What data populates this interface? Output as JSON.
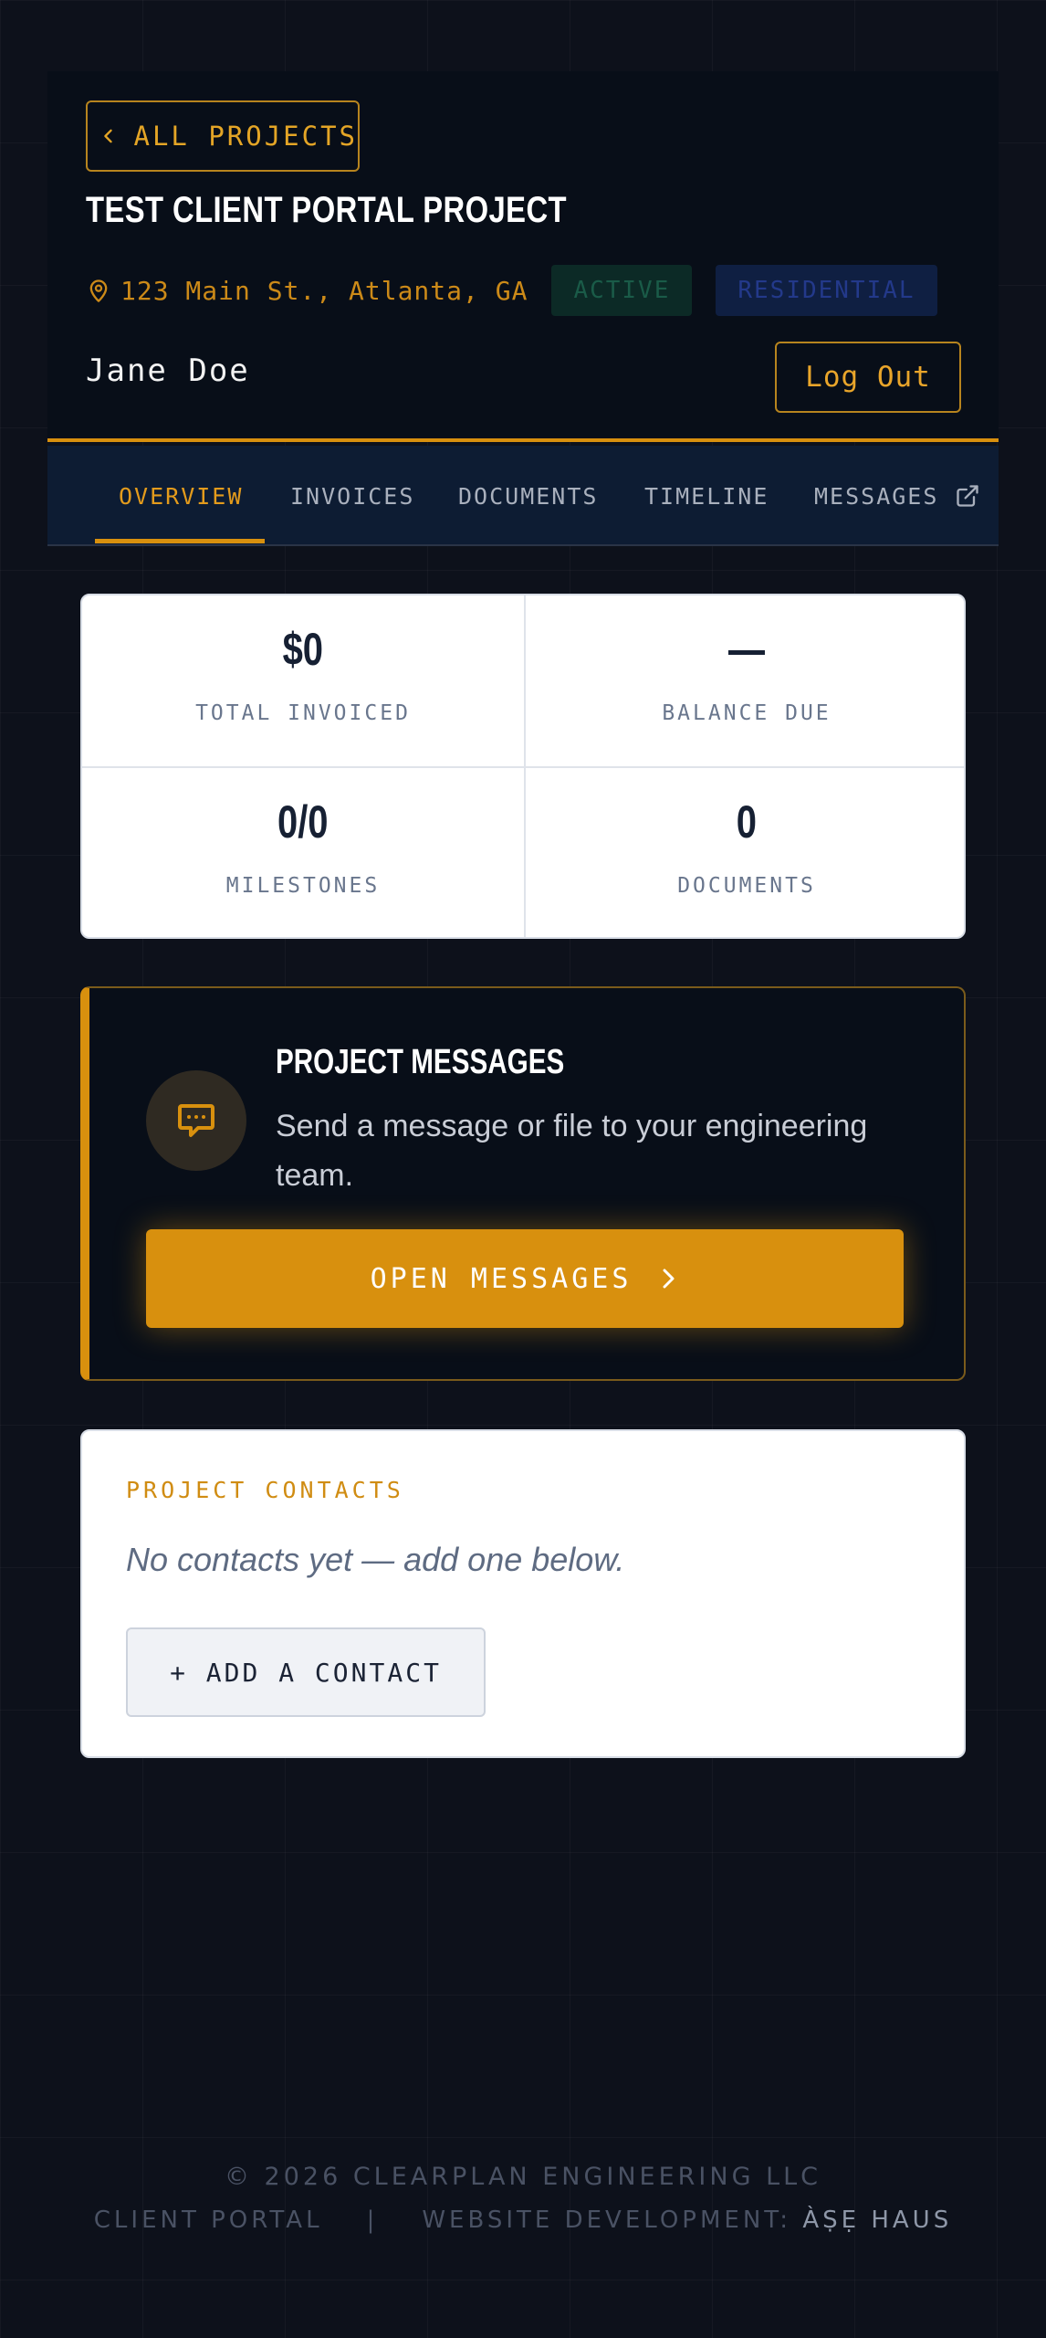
{
  "header": {
    "back_label": "ALL PROJECTS",
    "title": "TEST CLIENT PORTAL PROJECT",
    "location": "123 Main St., Atlanta, GA",
    "status_badge": "ACTIVE",
    "type_badge": "RESIDENTIAL",
    "user_name": "Jane Doe",
    "logout_label": "Log Out"
  },
  "tabs": [
    {
      "label": "OVERVIEW",
      "active": true
    },
    {
      "label": "INVOICES"
    },
    {
      "label": "DOCUMENTS"
    },
    {
      "label": "TIMELINE"
    },
    {
      "label": "MESSAGES",
      "icon": "external-link-icon"
    }
  ],
  "stats": [
    {
      "value": "$0",
      "label": "TOTAL INVOICED"
    },
    {
      "value": "—",
      "label": "BALANCE DUE"
    },
    {
      "value": "0/0",
      "label": "MILESTONES"
    },
    {
      "value": "0",
      "label": "DOCUMENTS"
    }
  ],
  "messages_card": {
    "icon": "chat-bubble-icon",
    "title": "PROJECT MESSAGES",
    "description": "Send a message or file to your engineering team.",
    "button_label": "OPEN MESSAGES"
  },
  "contacts_card": {
    "title": "PROJECT CONTACTS",
    "empty_text": "No contacts yet — add one below.",
    "add_label": "+ ADD A CONTACT"
  },
  "footer": {
    "copyright": "© 2026 CLEARPLAN ENGINEERING LLC",
    "portal_label": "CLIENT PORTAL",
    "separator": "|",
    "dev_prefix": "WEBSITE DEVELOPMENT:",
    "dev_name": "ÀṢẸ HAUS"
  },
  "colors": {
    "accent": "#d8900e",
    "background": "#0d111b",
    "header_bg": "#080e18",
    "tabs_bg": "#0d1c33"
  }
}
